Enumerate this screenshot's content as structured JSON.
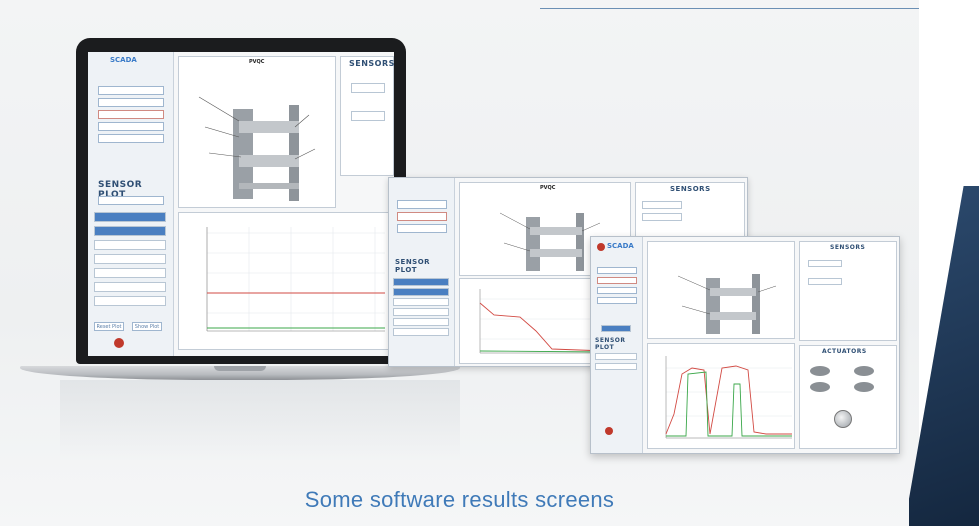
{
  "caption": "Some software results screens",
  "colors": {
    "accent": "#3f7ab8",
    "navy": "#1f3a5c",
    "plot_red": "#d24a43",
    "plot_green": "#3ba74a"
  },
  "laptop": {
    "brand": "SCADA",
    "buttons": [
      "",
      "",
      "",
      "",
      ""
    ],
    "sensor_plot_title": "SENSOR PLOT",
    "sensors_title": "SENSORS",
    "diagram_title": "PVQC",
    "footer_buttons": [
      "Reset Plot",
      "Show Plot"
    ]
  },
  "window2": {
    "sensors_title": "SENSORS",
    "sensor_plot_title": "SENSOR PLOT",
    "diagram_title": "PVQC"
  },
  "window3": {
    "brand": "SCADA",
    "sensors_title": "SENSORS",
    "sensor_plot_title": "SENSOR PLOT",
    "actuators_title": "ACTUATORS"
  }
}
